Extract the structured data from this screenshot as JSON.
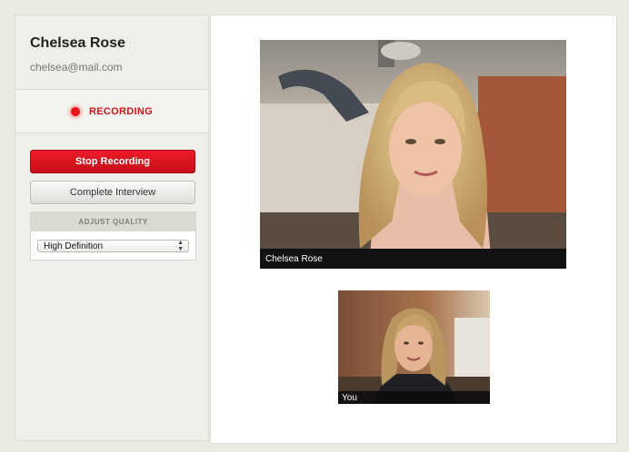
{
  "user": {
    "name": "Chelsea Rose",
    "email": "chelsea@mail.com"
  },
  "recording": {
    "status": "RECORDING",
    "indicator_color": "#e8141c"
  },
  "actions": {
    "stop_label": "Stop Recording",
    "complete_label": "Complete Interview"
  },
  "quality": {
    "header": "ADJUST QUALITY",
    "selected": "High Definition"
  },
  "videos": {
    "main_caption": "Chelsea Rose",
    "self_caption": "You"
  },
  "colors": {
    "accent": "#d0121a",
    "background": "#ecebe4"
  }
}
